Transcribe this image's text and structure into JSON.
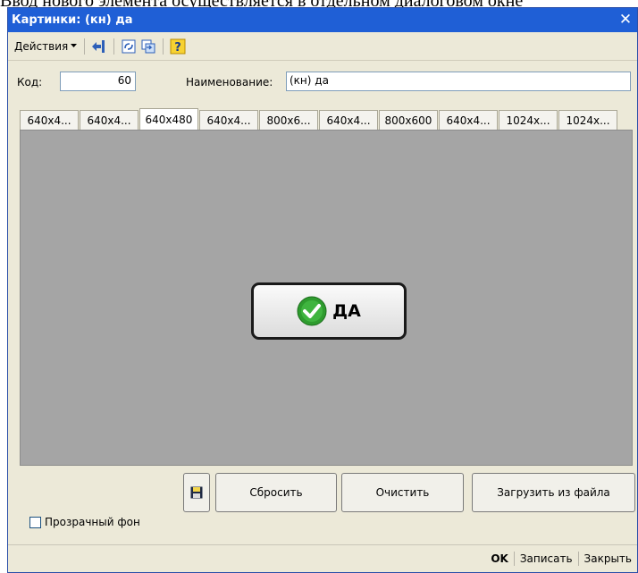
{
  "background_text": "Ввод нового элемента осуществляется в отдельном диалоговом окне",
  "window": {
    "title": "Картинки: (кн) да",
    "close_symbol": "✕"
  },
  "toolbar": {
    "actions_label": "Действия",
    "buttons": [
      "back-arrow-icon",
      "refresh-icon",
      "replace-icon",
      "help-icon"
    ],
    "help_symbol": "?"
  },
  "form": {
    "code_label": "Код:",
    "code_value": "60",
    "name_label": "Наименование:",
    "name_value": "(кн) да"
  },
  "tabs": [
    {
      "label": "640x4..."
    },
    {
      "label": "640x4..."
    },
    {
      "label": "640x480",
      "active": true
    },
    {
      "label": "640x4..."
    },
    {
      "label": "800x6..."
    },
    {
      "label": "640x4..."
    },
    {
      "label": "800x600"
    },
    {
      "label": "640x4..."
    },
    {
      "label": "1024x..."
    },
    {
      "label": "1024x..."
    }
  ],
  "image": {
    "button_text": "ДА",
    "check_color": "#2e9b2e"
  },
  "bottom": {
    "transparent_label": "Прозрачный фон",
    "reset_label": "Сбросить",
    "clear_label": "Очистить",
    "load_label": "Загрузить из файла"
  },
  "status": {
    "ok_label": "OK",
    "save_label": "Записать",
    "close_label": "Закрыть"
  }
}
